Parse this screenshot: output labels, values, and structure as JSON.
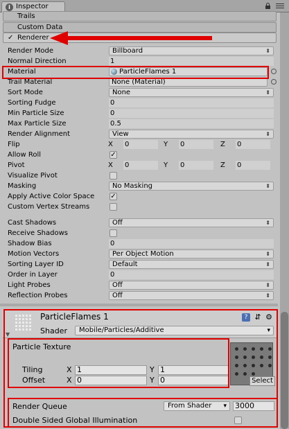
{
  "window": {
    "tab_label": "Inspector"
  },
  "modules": {
    "trails": "Trails",
    "custom_data": "Custom Data",
    "renderer": "Renderer"
  },
  "renderer": {
    "rows": [
      {
        "label": "Render Mode",
        "value": "Billboard"
      },
      {
        "label": "Normal Direction",
        "value": "1"
      },
      {
        "label": "Material",
        "value": "ParticleFlames 1"
      },
      {
        "label": "Trail Material",
        "value": "None (Material)"
      },
      {
        "label": "Sort Mode",
        "value": "None"
      },
      {
        "label": "Sorting Fudge",
        "value": "0"
      },
      {
        "label": "Min Particle Size",
        "value": "0"
      },
      {
        "label": "Max Particle Size",
        "value": "0.5"
      },
      {
        "label": "Render Alignment",
        "value": "View"
      },
      {
        "label": "Flip",
        "x": "0",
        "y": "0",
        "z": "0"
      },
      {
        "label": "Allow Roll",
        "value": "✓"
      },
      {
        "label": "Pivot",
        "x": "0",
        "y": "0",
        "z": "0"
      },
      {
        "label": "Visualize Pivot",
        "value": ""
      },
      {
        "label": "Masking",
        "value": "No Masking"
      },
      {
        "label": "Apply Active Color Space",
        "value": "✓"
      },
      {
        "label": "Custom Vertex Streams",
        "value": ""
      },
      {
        "label": "Cast Shadows",
        "value": "Off"
      },
      {
        "label": "Receive Shadows",
        "value": ""
      },
      {
        "label": "Shadow Bias",
        "value": "0"
      },
      {
        "label": "Motion Vectors",
        "value": "Per Object Motion"
      },
      {
        "label": "Sorting Layer ID",
        "value": "Default"
      },
      {
        "label": "Order in Layer",
        "value": "0"
      },
      {
        "label": "Light Probes",
        "value": "Off"
      },
      {
        "label": "Reflection Probes",
        "value": "Off"
      }
    ],
    "axis": {
      "x": "X",
      "y": "Y",
      "z": "Z"
    }
  },
  "material": {
    "name": "ParticleFlames 1",
    "shader_label": "Shader",
    "shader_value": "Mobile/Particles/Additive",
    "particle_texture": "Particle Texture",
    "tiling_label": "Tiling",
    "offset_label": "Offset",
    "tiling_x": "1",
    "tiling_y": "1",
    "offset_x": "0",
    "offset_y": "0",
    "select_label": "Select",
    "render_queue_label": "Render Queue",
    "render_queue_mode": "From Shader",
    "render_queue_value": "3000",
    "dsgi_label": "Double Sided Global Illumination"
  },
  "colors": {
    "highlight": "#e00000",
    "panel": "#c2c2c2"
  }
}
